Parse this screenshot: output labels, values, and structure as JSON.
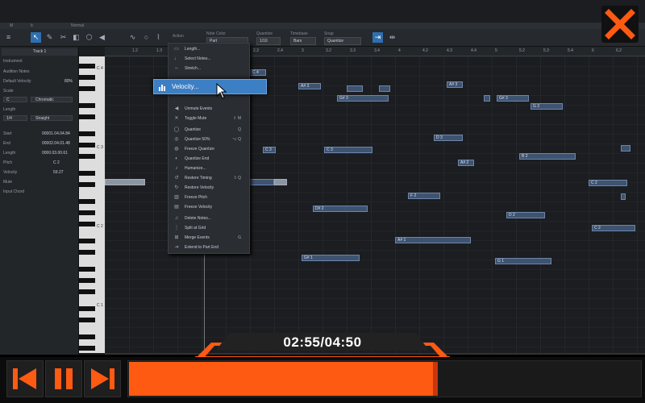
{
  "titlebar": {
    "left1": "M",
    "left2": "b",
    "center": "Normal"
  },
  "toolbar": {
    "action": "Action",
    "note_color_label": "Note Color",
    "note_color": "Part",
    "quantize_label": "Quantize",
    "quantize": "1/16",
    "timebase_label": "Timebase",
    "timebase": "Bars",
    "snap_label": "Snap",
    "snap": "Quantize"
  },
  "inspector": {
    "track": "Track 1",
    "instrument": "Instrument",
    "audition": "Audition Notes",
    "default_velocity_label": "Default Velocity",
    "default_velocity": "80%",
    "scale_label": "Scale",
    "scale_key": "C",
    "scale_type": "Chromatic",
    "length_label": "Length",
    "length": "1/4",
    "length_mode": "Straight",
    "start_label": "Start",
    "start": "00001.04.04.84",
    "end_label": "End",
    "end": "00002.04.01.48",
    "length2_label": "Length",
    "length2": "0000.03.00.61",
    "pitch_label": "Pitch",
    "pitch": "C 2",
    "velocity_label": "Velocity",
    "velocity": "59.27",
    "mute_label": "Mute",
    "input_chord_label": "Input Chord"
  },
  "keyboard": {
    "octaves": [
      "C 4",
      "C 3",
      "C 2",
      "C 1"
    ]
  },
  "ruler": [
    "1.2",
    "1.3",
    "1.4",
    "2",
    "2.2",
    "2.3",
    "2.4",
    "3",
    "3.2",
    "3.3",
    "3.4",
    "4",
    "4.2",
    "4.3",
    "4.4",
    "5",
    "5.2",
    "5.3",
    "5.4",
    "6",
    "6.2"
  ],
  "notes": [
    {
      "label": "C 4"
    },
    {
      "label": "A# 3"
    },
    {
      "label": "A# 3"
    },
    {
      "label": "G# 3"
    },
    {
      "label": "G# 3"
    },
    {
      "label": "G 3"
    },
    {
      "label": "D 3"
    },
    {
      "label": "C 3"
    },
    {
      "label": "C 3"
    },
    {
      "label": "B 2"
    },
    {
      "label": "A# 2"
    },
    {
      "label": "F 2"
    },
    {
      "label": "C 2"
    },
    {
      "label": "D# 2"
    },
    {
      "label": "D 2"
    },
    {
      "label": "C 2"
    },
    {
      "label": "A# 1"
    },
    {
      "label": "G# 1"
    },
    {
      "label": "G 1"
    }
  ],
  "menu": {
    "items": [
      {
        "label": "Length...",
        "icon": "length-icon",
        "shortcut": ""
      },
      {
        "label": "Select Notes...",
        "icon": "notes-icon",
        "shortcut": ""
      },
      {
        "label": "Stretch...",
        "icon": "stretch-icon",
        "shortcut": ""
      },
      {
        "label": "Unmute Events",
        "icon": "speaker-icon",
        "shortcut": ""
      },
      {
        "label": "Toggle Mute",
        "icon": "mute-icon",
        "shortcut": "⇧ M"
      },
      {
        "label": "Quantize",
        "icon": "quantize-icon",
        "shortcut": "Q"
      },
      {
        "label": "Quantize 50%",
        "icon": "quantize-half-icon",
        "shortcut": "⌥ Q"
      },
      {
        "label": "Freeze Quantize",
        "icon": "freeze-quantize-icon",
        "shortcut": ""
      },
      {
        "label": "Quantize End",
        "icon": "quantize-end-icon",
        "shortcut": ""
      },
      {
        "label": "Humanize...",
        "icon": "humanize-icon",
        "shortcut": ""
      },
      {
        "label": "Restore Timing",
        "icon": "restore-timing-icon",
        "shortcut": "⇧ Q"
      },
      {
        "label": "Restore Velocity",
        "icon": "restore-velocity-icon",
        "shortcut": ""
      },
      {
        "label": "Freeze Pitch",
        "icon": "freeze-pitch-icon",
        "shortcut": ""
      },
      {
        "label": "Freeze Velocity",
        "icon": "freeze-velocity-icon",
        "shortcut": ""
      },
      {
        "label": "Delete Notes...",
        "icon": "delete-notes-icon",
        "shortcut": ""
      },
      {
        "label": "Split at Grid",
        "icon": "split-icon",
        "shortcut": ""
      },
      {
        "label": "Merge Events",
        "icon": "merge-icon",
        "shortcut": "G"
      },
      {
        "label": "Extend to Part End",
        "icon": "extend-icon",
        "shortcut": ""
      }
    ],
    "highlight": "Velocity..."
  },
  "player": {
    "time": "02:55/04:50",
    "progress": 0.6,
    "accent": "#ff5a12"
  }
}
